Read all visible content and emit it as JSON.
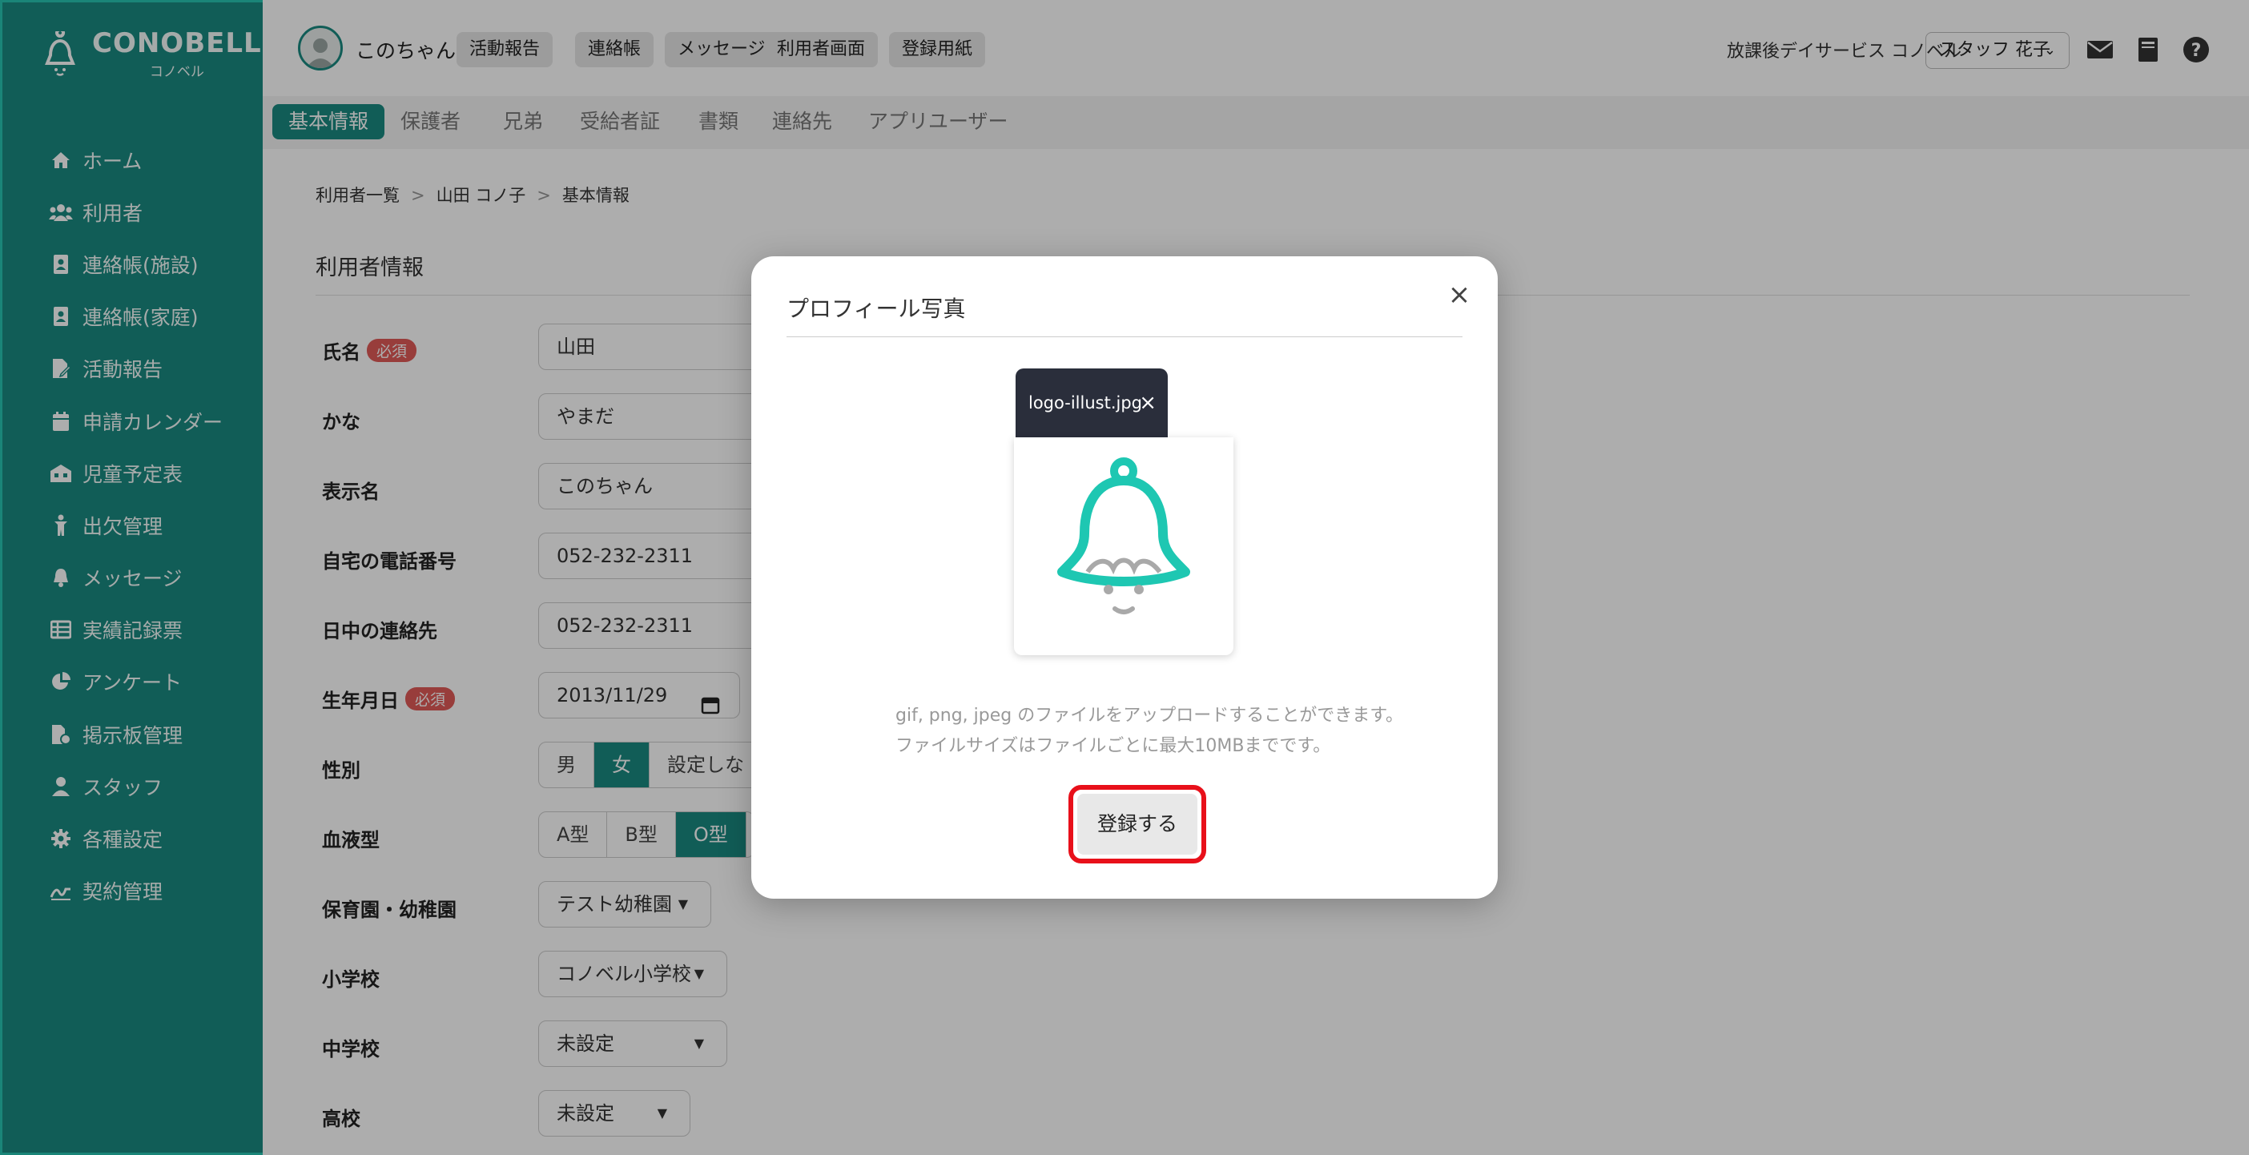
{
  "app": {
    "logo": "CONOBELL",
    "logo_sub": "コノベル"
  },
  "sidebar": {
    "items": [
      {
        "label": "ホーム",
        "icon": "home-icon"
      },
      {
        "label": "利用者",
        "icon": "users-icon"
      },
      {
        "label": "連絡帳(施設)",
        "icon": "contact-book-icon"
      },
      {
        "label": "連絡帳(家庭)",
        "icon": "contact-book-icon"
      },
      {
        "label": "活動報告",
        "icon": "report-icon"
      },
      {
        "label": "申請カレンダー",
        "icon": "calendar-icon"
      },
      {
        "label": "児童予定表",
        "icon": "schedule-icon"
      },
      {
        "label": "出欠管理",
        "icon": "attendance-icon"
      },
      {
        "label": "メッセージ",
        "icon": "bell-icon"
      },
      {
        "label": "実績記録票",
        "icon": "table-icon"
      },
      {
        "label": "アンケート",
        "icon": "pie-chart-icon"
      },
      {
        "label": "掲示板管理",
        "icon": "board-icon"
      },
      {
        "label": "スタッフ",
        "icon": "person-icon"
      },
      {
        "label": "各種設定",
        "icon": "gear-icon"
      },
      {
        "label": "契約管理",
        "icon": "contract-icon"
      }
    ]
  },
  "header": {
    "user_name": "このちゃん",
    "buttons": [
      "活動報告",
      "連絡帳",
      "メッセージ",
      "利用者画面",
      "登録用紙"
    ],
    "facility": "放課後デイサービス コノベル",
    "staff": "スタッフ 花子"
  },
  "subnav": {
    "tabs": [
      "基本情報",
      "保護者",
      "兄弟",
      "受給者証",
      "書類",
      "連絡先",
      "アプリユーザー"
    ],
    "active": "基本情報"
  },
  "breadcrumb": [
    "利用者一覧",
    "山田 コノ子",
    "基本情報"
  ],
  "section_title": "利用者情報",
  "form": {
    "required": "必須",
    "name_label": "氏名",
    "name_value": "山田",
    "kana_label": "かな",
    "kana_value": "やまだ",
    "display_label": "表示名",
    "display_value": "このちゃん",
    "home_phone_label": "自宅の電話番号",
    "home_phone_value": "052-232-2311",
    "day_contact_label": "日中の連絡先",
    "day_contact_value": "052-232-2311",
    "birth_label": "生年月日",
    "birth_value": "2013/11/29",
    "gender_label": "性別",
    "gender_options": [
      "男",
      "女",
      "設定しない"
    ],
    "gender_selected": "女",
    "blood_label": "血液型",
    "blood_options": [
      "A型",
      "B型",
      "O型"
    ],
    "blood_selected": "O型",
    "nursery_label": "保育園・幼稚園",
    "nursery_value": "テスト幼稚園",
    "elementary_label": "小学校",
    "elementary_value": "コノベル小学校",
    "junior_label": "中学校",
    "junior_value": "未設定",
    "high_label": "高校",
    "high_value": "未設定"
  },
  "modal": {
    "title": "プロフィール写真",
    "file_name": "logo-illust.jpg",
    "hint_line1": "gif, png, jpeg のファイルをアップロードすることができます。",
    "hint_line2": "ファイルサイズはファイルごとに最大10MBまでです。",
    "submit": "登録する",
    "highlight_color": "#e8101a"
  },
  "colors": {
    "brand": "#1a8a80",
    "accent": "#27c4b2",
    "required": "#e05a58"
  }
}
